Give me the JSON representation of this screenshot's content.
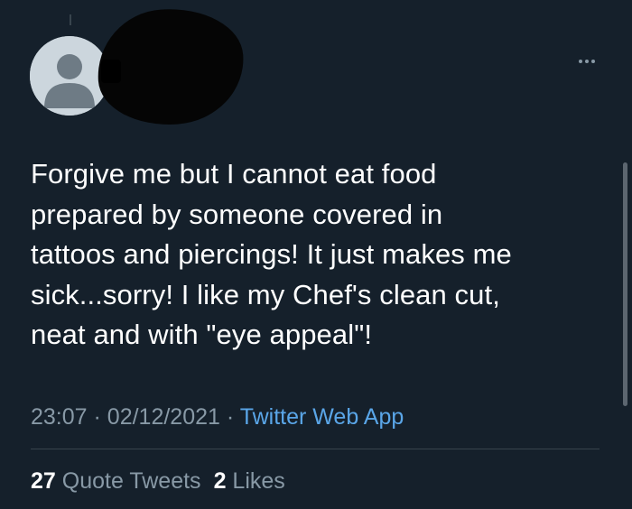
{
  "tweet": {
    "text": "Forgive me but I cannot eat food\nprepared by someone covered in\ntattoos and piercings! It just makes me\nsick...sorry! I like my Chef's clean cut,\nneat and with \"eye appeal\"!",
    "time": "23:07",
    "date": "02/12/2021",
    "separator": "·",
    "source": "Twitter Web App"
  },
  "stats": {
    "quote_tweets_count": "27",
    "quote_tweets_label": "Quote Tweets",
    "likes_count": "2",
    "likes_label": "Likes"
  },
  "icons": {
    "more": "more-horizontal-icon",
    "avatar": "default-avatar-icon"
  },
  "colors": {
    "background": "#15202b",
    "text": "#ffffff",
    "secondary_text": "#8899a6",
    "link": "#5aa6e8",
    "divider": "#38444d"
  }
}
